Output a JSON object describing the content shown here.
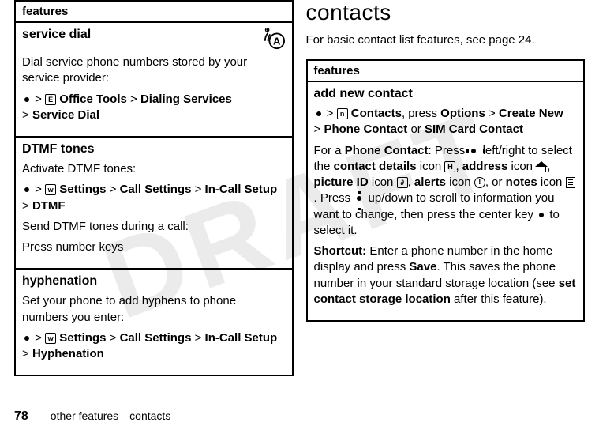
{
  "watermark": "DRAFT",
  "left": {
    "header": "features",
    "rows": [
      {
        "title": "service dial",
        "has_at_icon": true,
        "body_plain": "Dial service phone numbers stored by your service provider:",
        "path_heavy1": "Office Tools",
        "path_heavy2": "Dialing Services",
        "path_heavy3": "Service Dial"
      },
      {
        "title": "DTMF tones",
        "body_plain": "Activate DTMF tones:",
        "path_heavy1": "Settings",
        "path_heavy2": "Call Settings",
        "path_heavy3": "In-Call Setup",
        "path_heavy4": "DTMF",
        "body_plain2": "Send DTMF tones during a call:",
        "body_plain3": "Press number keys"
      },
      {
        "title": "hyphenation",
        "body_plain": "Set your phone to add hyphens to phone numbers you enter:",
        "path_heavy1": "Settings",
        "path_heavy2": "Call Settings",
        "path_heavy3": "In-Call Setup",
        "path_heavy4": "Hyphenation"
      }
    ]
  },
  "right": {
    "heading": "contacts",
    "intro": "For basic contact list features, see page 24.",
    "header": "features",
    "row": {
      "title": "add new contact",
      "path_contacts": "Contacts",
      "path_options": "Options",
      "path_create": "Create New",
      "path_phone_contact": "Phone Contact",
      "path_or": "or",
      "path_sim_contact": "SIM Card Contact",
      "para_for_a": "For a",
      "para_phone_contact": "Phone Contact",
      "para_press": ": Press",
      "para_leftright": "left/right to select the",
      "para_contact_details": "contact details",
      "para_icon": "icon",
      "para_address": "address",
      "para_picture_id": "picture ID",
      "para_alerts": "alerts",
      "para_or": "or",
      "para_notes": "notes",
      "para_press2": ". Press",
      "para_updown": "up/down to scroll to information you want to change, then press the center key",
      "para_select": "to select it.",
      "shortcut_label": "Shortcut:",
      "shortcut_body1": "Enter a phone number in the home display and press",
      "shortcut_save": "Save",
      "shortcut_body2": ". This saves the phone number in your standard storage location (see",
      "shortcut_bold": "set contact storage location",
      "shortcut_body3": "after this feature)."
    }
  },
  "footer": {
    "page": "78",
    "text": "other features—contacts"
  },
  "gt": ">",
  "comma_press": ", press"
}
